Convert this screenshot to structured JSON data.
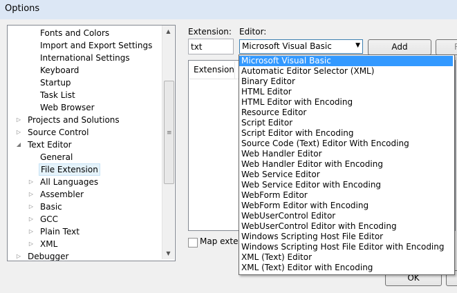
{
  "window": {
    "title": "Options"
  },
  "tree": {
    "rows": [
      {
        "label": "Fonts and Colors",
        "expander": "",
        "indent": 2,
        "selected": false
      },
      {
        "label": "Import and Export Settings",
        "expander": "",
        "indent": 2,
        "selected": false
      },
      {
        "label": "International Settings",
        "expander": "",
        "indent": 2,
        "selected": false
      },
      {
        "label": "Keyboard",
        "expander": "",
        "indent": 2,
        "selected": false
      },
      {
        "label": "Startup",
        "expander": "",
        "indent": 2,
        "selected": false
      },
      {
        "label": "Task List",
        "expander": "",
        "indent": 2,
        "selected": false
      },
      {
        "label": "Web Browser",
        "expander": "",
        "indent": 2,
        "selected": false
      },
      {
        "label": "Projects and Solutions",
        "expander": "collapsed",
        "indent": 1,
        "selected": false
      },
      {
        "label": "Source Control",
        "expander": "collapsed",
        "indent": 1,
        "selected": false
      },
      {
        "label": "Text Editor",
        "expander": "expanded",
        "indent": 1,
        "selected": false
      },
      {
        "label": "General",
        "expander": "",
        "indent": 2,
        "selected": false
      },
      {
        "label": "File Extension",
        "expander": "",
        "indent": 2,
        "selected": true
      },
      {
        "label": "All Languages",
        "expander": "collapsed",
        "indent": 2,
        "selected": false
      },
      {
        "label": "Assembler",
        "expander": "collapsed",
        "indent": 2,
        "selected": false
      },
      {
        "label": "Basic",
        "expander": "collapsed",
        "indent": 2,
        "selected": false
      },
      {
        "label": "GCC",
        "expander": "collapsed",
        "indent": 2,
        "selected": false
      },
      {
        "label": "Plain Text",
        "expander": "collapsed",
        "indent": 2,
        "selected": false
      },
      {
        "label": "XML",
        "expander": "collapsed",
        "indent": 2,
        "selected": false
      },
      {
        "label": "Debugger",
        "expander": "collapsed",
        "indent": 1,
        "selected": false
      }
    ]
  },
  "form": {
    "extension_label": "Extension:",
    "extension_value": "txt",
    "editor_label": "Editor:",
    "editor_value": "Microsoft Visual Basic",
    "add_label": "Add",
    "remove_label": "R",
    "list_column": "Extension",
    "map_checkbox_label": "Map extens",
    "ok_label": "OK"
  },
  "dropdown": {
    "items": [
      "Microsoft Visual Basic",
      "Automatic Editor Selector (XML)",
      "Binary Editor",
      "HTML Editor",
      "HTML Editor with Encoding",
      "Resource Editor",
      "Script Editor",
      "Script Editor with Encoding",
      "Source Code (Text) Editor With Encoding",
      "Web Handler Editor",
      "Web Handler Editor with Encoding",
      "Web Service Editor",
      "Web Service Editor with Encoding",
      "WebForm Editor",
      "WebForm Editor with Encoding",
      "WebUserControl Editor",
      "WebUserControl Editor with Encoding",
      "Windows Scripting Host File Editor",
      "Windows Scripting Host File Editor with Encoding",
      "XML (Text) Editor",
      "XML (Text) Editor with Encoding"
    ],
    "selected_index": 0
  },
  "colors": {
    "selection": "#3399ff",
    "tree_selection": "#e5f3fb"
  }
}
